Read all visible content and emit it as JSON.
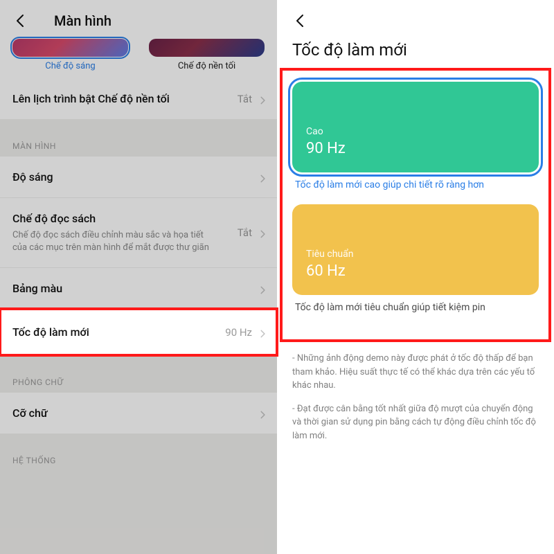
{
  "left": {
    "title": "Màn hình",
    "theme_light_label": "Chế độ sáng",
    "theme_dark_label": "Chế độ nền tối",
    "schedule_label": "Lên lịch trình bật Chế độ nền tối",
    "schedule_value": "Tắt",
    "section_screen": "MÀN HÌNH",
    "brightness_label": "Độ sáng",
    "reading_label": "Chế độ đọc sách",
    "reading_sub": "Chế độ đọc sách điều chỉnh màu sắc và họa tiết của các mục trên màn hình để mắt được thư giãn",
    "reading_value": "Tắt",
    "palette_label": "Bảng màu",
    "refresh_label": "Tốc độ làm mới",
    "refresh_value": "90 Hz",
    "section_font": "PHÔNG CHỮ",
    "fontsize_label": "Cỡ chữ",
    "section_system": "HỆ THỐNG"
  },
  "right": {
    "page_title": "Tốc độ làm mới",
    "high_name": "Cao",
    "high_hz": "90 Hz",
    "high_caption": "Tốc độ làm mới cao giúp chi tiết rõ ràng hơn",
    "std_name": "Tiêu chuẩn",
    "std_hz": "60 Hz",
    "std_caption": "Tốc độ làm mới tiêu chuẩn giúp tiết kiệm pin",
    "note1": "- Những ảnh động demo này được phát ở tốc độ thấp để bạn tham khảo. Hiệu suất thực tế có thể khác dựa trên các yếu tố khác nhau.",
    "note2": "- Đạt được cân bằng tốt nhất giữa độ mượt của chuyển động và thời gian sử dụng pin bằng cách tự động điều chỉnh tốc độ làm mới."
  },
  "colors": {
    "highlight_border": "#ff1a1a",
    "accent_blue": "#2a7ee6",
    "card_high": "#30c795",
    "card_std": "#f2c24d"
  }
}
